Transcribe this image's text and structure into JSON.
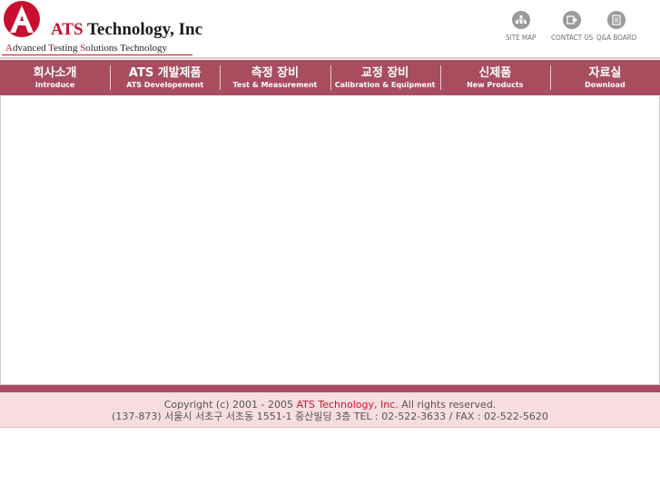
{
  "header": {
    "logo_letter": "A",
    "logo_ats": "ATS",
    "logo_rest": " Technology, Inc",
    "tagline_parts": [
      "A",
      "dvanced ",
      "T",
      "esting ",
      "S",
      "olutions Technology"
    ]
  },
  "utility_links": [
    {
      "label": "SITE MAP",
      "icon": "sitemap-icon"
    },
    {
      "label": "CONTACT US",
      "icon": "contact-icon"
    },
    {
      "label": "Q&A BOARD",
      "icon": "board-icon"
    }
  ],
  "nav": [
    {
      "ko": "회사소개",
      "en": "Introduce"
    },
    {
      "ko": "ATS 개발제품",
      "en": "ATS Developement"
    },
    {
      "ko": "측정 장비",
      "en": "Test & Measurement"
    },
    {
      "ko": "교정 장비",
      "en": "Calibration & Equipment"
    },
    {
      "ko": "신제품",
      "en": "New Products"
    },
    {
      "ko": "자료실",
      "en": "Download"
    }
  ],
  "footer": {
    "copyright_prefix": "Copyright (c) 2001 - 2005 ",
    "company": "ATS Technology, Inc.",
    "copyright_suffix": " All rights reserved.",
    "address": "(137-873) 서울시 서초구 서초동 1551-1 중산빌딩 3층 TEL : 02-522-3633 / FAX : 02-522-5620"
  },
  "colors": {
    "nav_bg": "#a74d5e",
    "brand_red": "#c8102e",
    "footer_bg": "#f7dde0"
  }
}
